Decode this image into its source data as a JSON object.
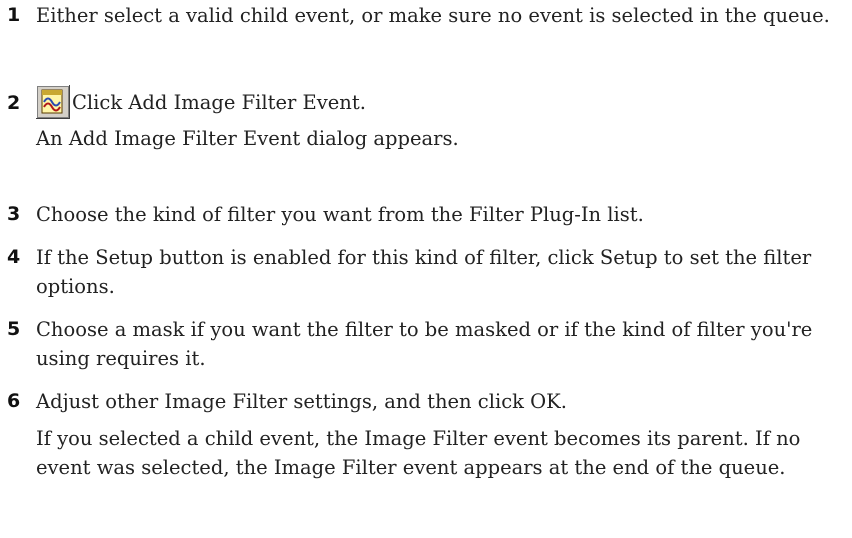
{
  "steps": [
    {
      "number": "1",
      "text": "Either select a valid child event, or make sure no event is selected in the queue."
    },
    {
      "number": "2",
      "icon": "add-image-filter-event-icon",
      "text": "Click Add Image Filter Event.",
      "note": "An Add Image Filter Event dialog appears."
    },
    {
      "number": "3",
      "text": "Choose the kind of filter you want from the Filter Plug-In list."
    },
    {
      "number": "4",
      "text": "If the Setup button is enabled for this kind of filter, click Setup to set the filter options."
    },
    {
      "number": "5",
      "text": "Choose a mask if you want the filter to be masked or if the kind of filter you're using requires it."
    },
    {
      "number": "6",
      "text": "Adjust other Image Filter settings, and then click OK.",
      "note": "If you selected a child event, the Image Filter event becomes its parent. If no event was selected, the Image Filter event appears at the end of the queue."
    }
  ]
}
